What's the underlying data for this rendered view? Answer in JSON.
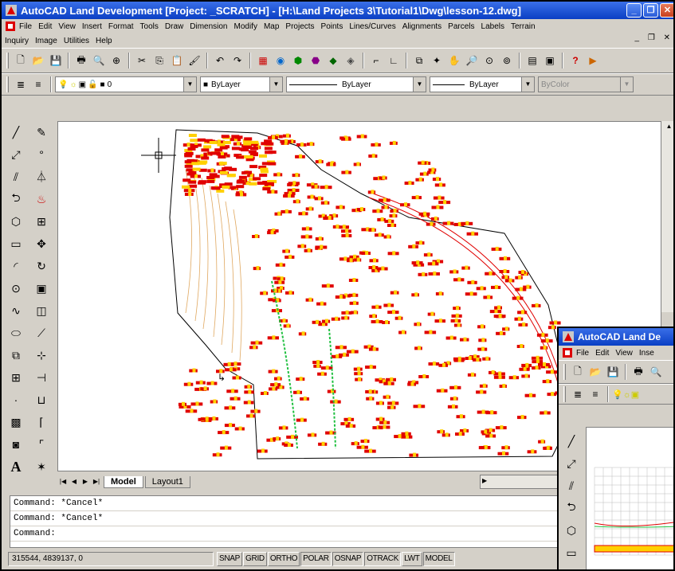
{
  "main": {
    "title": "AutoCAD Land Development [Project: _SCRATCH] - [H:\\Land Projects 3\\Tutorial1\\Dwg\\lesson-12.dwg]",
    "menu_row1": [
      "File",
      "Edit",
      "View",
      "Insert",
      "Format",
      "Tools",
      "Draw",
      "Dimension",
      "Modify",
      "Map",
      "Projects",
      "Points",
      "Lines/Curves",
      "Alignments",
      "Parcels",
      "Labels",
      "Terrain"
    ],
    "menu_row2": [
      "Inquiry",
      "Image",
      "Utilities",
      "Help"
    ],
    "layer_combo": "0",
    "color_combo": "ByLayer",
    "linetype_combo": "ByLayer",
    "lineweight_combo": "ByLayer",
    "plotstyle_combo": "ByColor",
    "tabs": [
      "Model",
      "Layout1"
    ],
    "command_lines": [
      "Command: *Cancel*",
      "Command: *Cancel*",
      "Command:"
    ],
    "coordinates": "315544, 4839137, 0",
    "status_buttons": [
      "SNAP",
      "GRID",
      "ORTHO",
      "POLAR",
      "OSNAP",
      "OTRACK",
      "LWT",
      "MODEL"
    ]
  },
  "sub": {
    "title": "AutoCAD Land De",
    "menu": [
      "File",
      "Edit",
      "View",
      "Inse"
    ]
  },
  "icons": {
    "app": "autocad-app-icon",
    "minimize": "minimize-icon",
    "maximize": "maximize-icon",
    "close": "close-icon"
  },
  "colors": {
    "title_bar": "#0a3fc4",
    "contour": "#e0a860",
    "lot_red": "#e00000",
    "lot_yellow": "#ffd000",
    "road_green": "#20c040"
  }
}
